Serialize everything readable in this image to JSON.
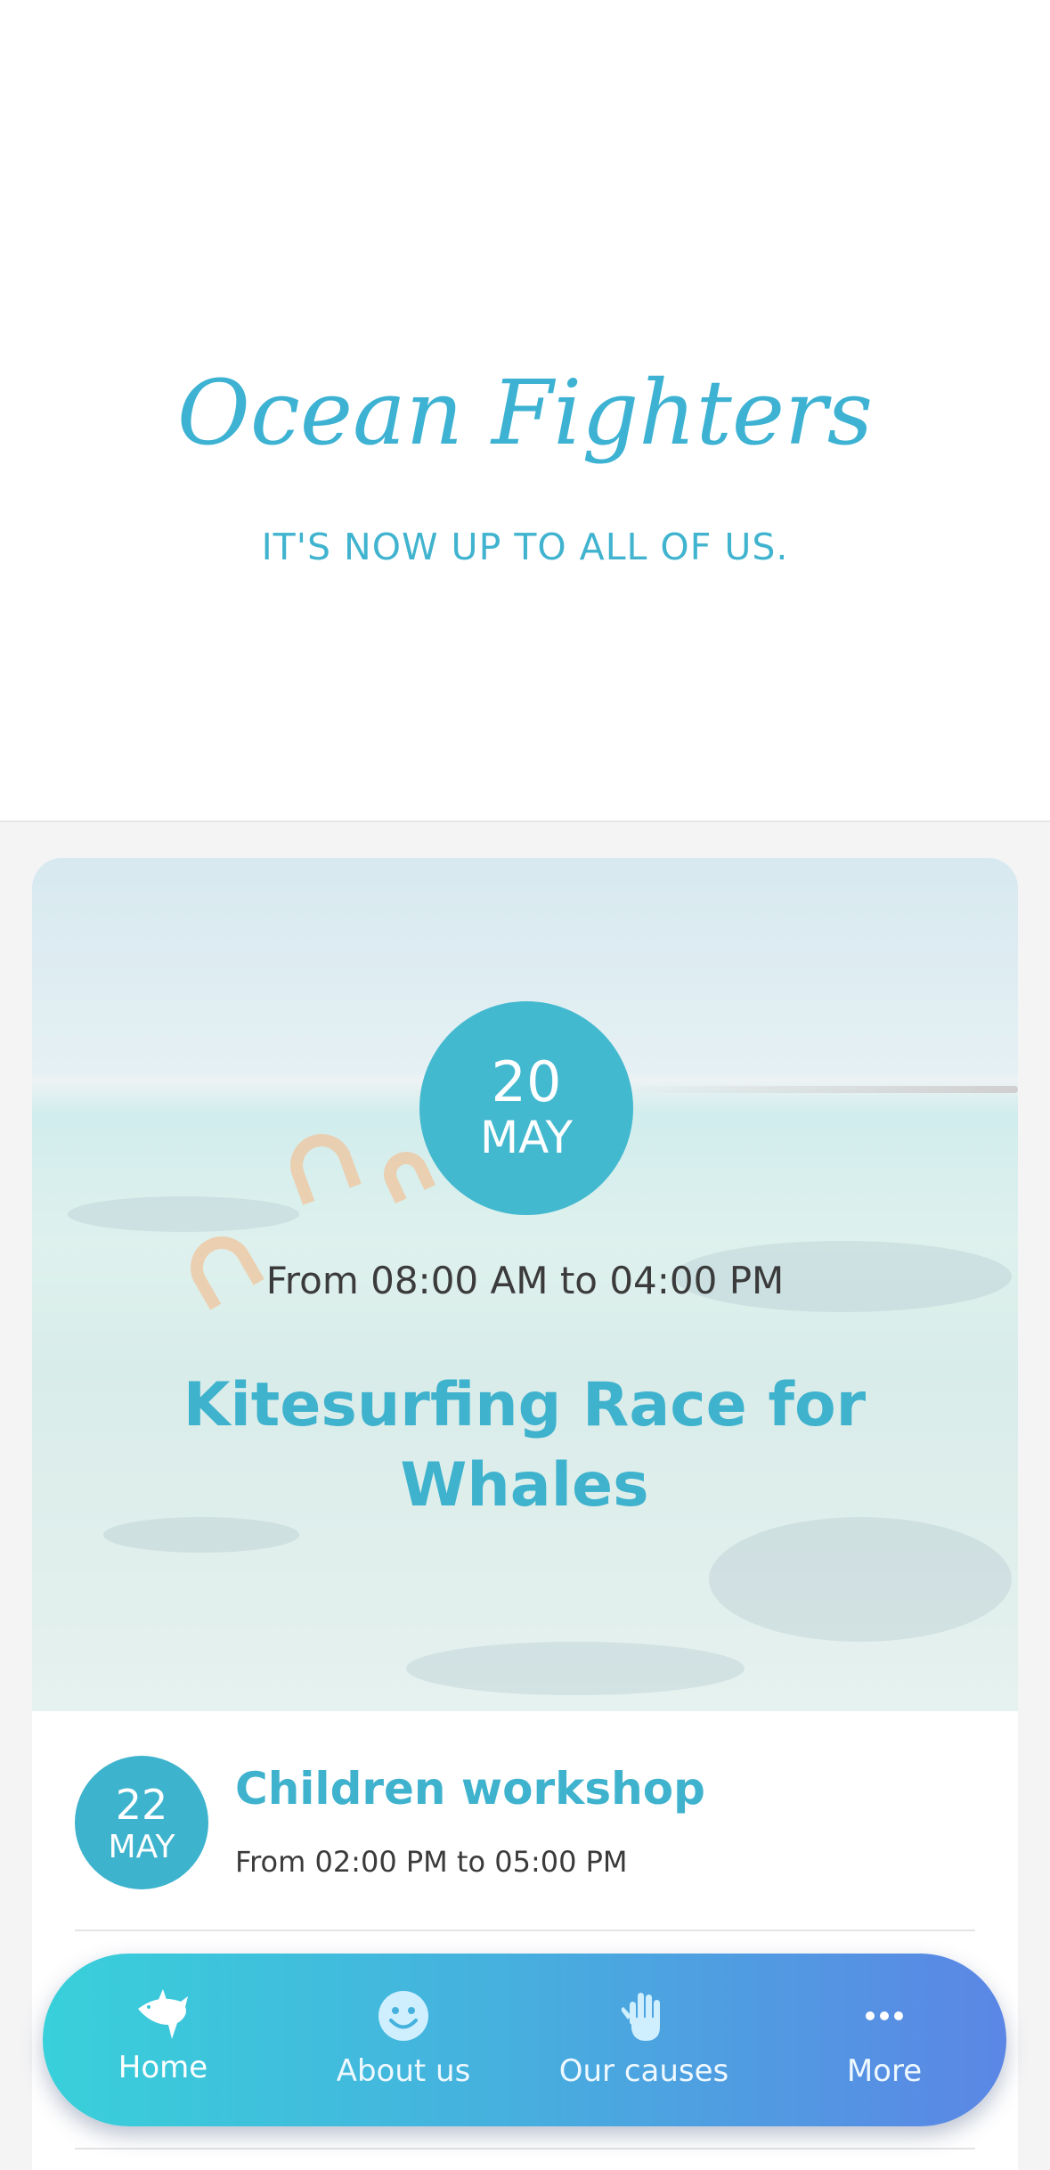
{
  "header": {
    "brand": "Ocean Fighters",
    "tagline": "IT'S NOW UP TO ALL OF US."
  },
  "featured_event": {
    "day": "20",
    "month": "MAY",
    "time": "From 08:00 AM to 04:00 PM",
    "title": "Kitesurfing Race for Whales"
  },
  "events": [
    {
      "day": "22",
      "month": "MAY",
      "title": "Children workshop",
      "time": "From 02:00 PM to 05:00 PM"
    }
  ],
  "tabbar": {
    "items": [
      {
        "label": "Home",
        "icon": "shark-icon",
        "active": true
      },
      {
        "label": "About us",
        "icon": "smiley-icon",
        "active": false
      },
      {
        "label": "Our causes",
        "icon": "hand-icon",
        "active": false
      },
      {
        "label": "More",
        "icon": "more-dots-icon",
        "active": false
      }
    ]
  },
  "colors": {
    "accent": "#3fb2cd",
    "tab_gradient_start": "#38d0da",
    "tab_gradient_end": "#5b86e5"
  }
}
